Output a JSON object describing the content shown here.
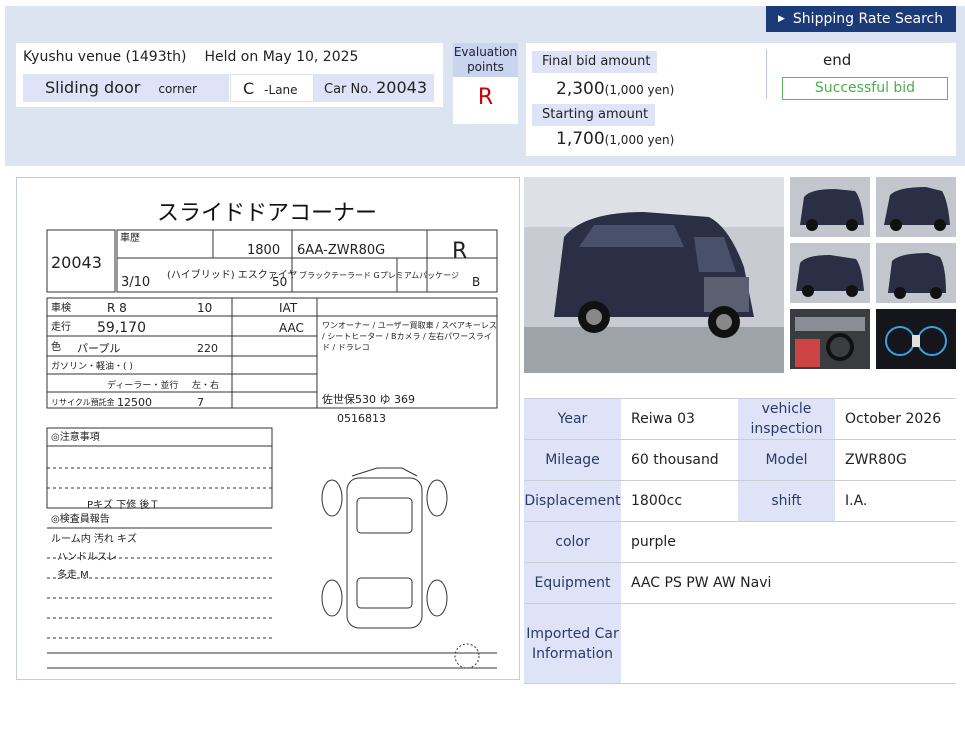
{
  "header": {
    "shipping_button": "Shipping Rate Search",
    "venue": "Kyushu venue (1493th)",
    "held": "Held on May 10, 2025",
    "corner_name": "Sliding door",
    "corner_suffix": "corner",
    "lane_letter": "C",
    "lane_suffix": "-Lane",
    "car_no_label": "Car No.",
    "car_no": "20043"
  },
  "evaluation": {
    "label": "Evaluation points",
    "value": "R"
  },
  "bid": {
    "final_label": "Final bid amount",
    "final_value": "2,300",
    "final_unit": "(1,000 yen)",
    "start_label": "Starting amount",
    "start_value": "1,700",
    "start_unit": "(1,000 yen)",
    "status": "end",
    "result": "Successful bid"
  },
  "sheet": {
    "title": "スライドドアコーナー",
    "lot_no": "20043",
    "displacement": "1800",
    "model_code": "6AA-ZWR80G",
    "grade_rating": "R",
    "interior_rating": "B",
    "first_reg": "3/10",
    "car_name": "(ハイブリッド) エスクァイヤ",
    "doors": "50",
    "grade": "ブラックテーラード Gプレミアムパッケージ",
    "inspection_year": "R 8",
    "inspection_month": "10",
    "shift": "IAT",
    "mileage": "59,170",
    "aircon": "AAC",
    "color": "パープル",
    "color_code": "220",
    "recycle": "12500",
    "capacity": "7",
    "reg_no": "佐世保530 ゆ 369",
    "chassis": "0516813",
    "notes": "ワンオーナー / ユーザー買取車 / スペアキーレス / シートヒーター / Bカメラ / 左右パワースライド / ドラレコ",
    "fuel": "ガソリン・軽油・(        )",
    "dealer": "ディーラー・並行",
    "handle": "左・右",
    "label_history": "車歴",
    "label_inspection": "車検",
    "label_mileage": "走行",
    "label_color": "色",
    "label_recycle": "リサイクル預託金",
    "label_caution": "◎注意事項",
    "label_inspector": "◎検査員報告",
    "inspector_note_1": "ルーム内 汚れ キズ",
    "inspector_note_2": "ハンドルスレ",
    "inspector_note_3": "多走 M",
    "repair_note": "Pキズ 下修 後Ｔ"
  },
  "specs": {
    "rows": [
      {
        "h1": "Year",
        "v1": "Reiwa 03",
        "h2": "vehicle inspection",
        "v2": "October 2026"
      },
      {
        "h1": "Mileage",
        "v1": "60 thousand",
        "h2": "Model",
        "v2": "ZWR80G"
      },
      {
        "h1": "Displacement",
        "v1": "1800cc",
        "h2": "shift",
        "v2": "I.A."
      },
      {
        "h1": "color",
        "v1": "purple"
      },
      {
        "h1": "Equipment",
        "v1": "AAC PS PW AW Navi"
      },
      {
        "h1": "Imported Car Information",
        "v1": ""
      }
    ]
  },
  "colors": {
    "accent": "#1b3a78",
    "label_bg": "#dfe3f7",
    "eval_red": "#cc0000",
    "success_green": "#4cae4c",
    "page_bg": "#dbe4f0"
  }
}
